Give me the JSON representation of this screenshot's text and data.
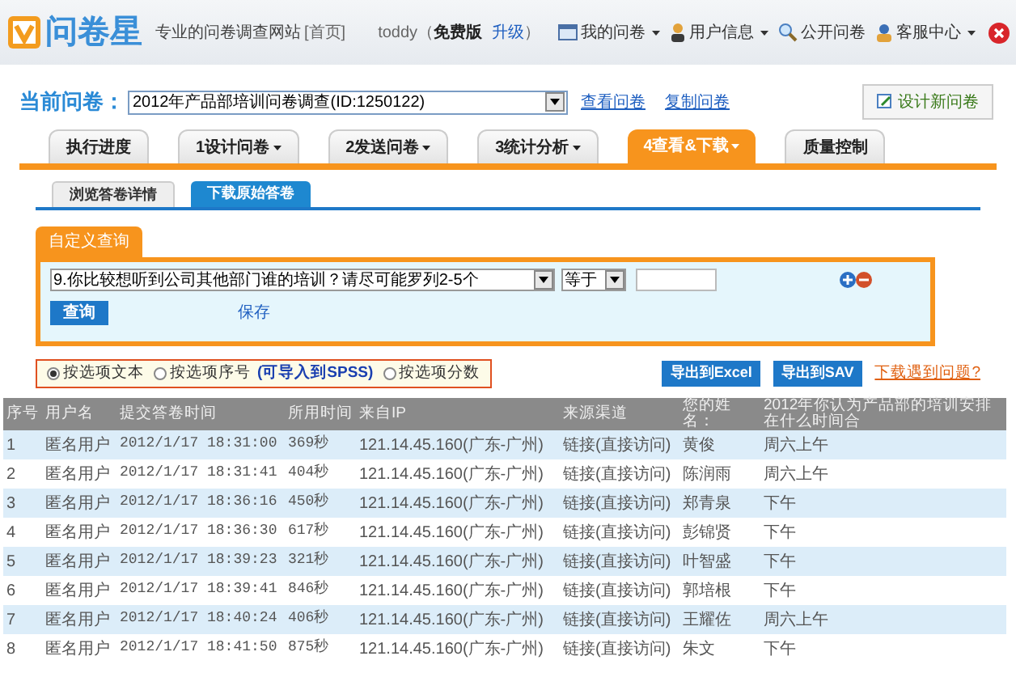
{
  "header": {
    "logo": "问卷星",
    "tagline": "专业的问卷调查网站",
    "home_link": "[首页]",
    "user": "toddy（",
    "edition": "免费版",
    "upgrade": "升级",
    "user_suffix": "）",
    "nav": [
      {
        "label": "我的问卷",
        "kind": "folder",
        "dropdown": true
      },
      {
        "label": "用户信息",
        "kind": "user",
        "dropdown": true
      },
      {
        "label": "公开问卷",
        "kind": "search",
        "dropdown": false
      },
      {
        "label": "客服中心",
        "kind": "support",
        "dropdown": true
      }
    ]
  },
  "current": {
    "label": "当前问卷：",
    "value": "2012年产品部培训问卷调查(ID:1250122)",
    "links": [
      "查看问卷",
      "复制问卷"
    ],
    "new_button": "设计新问卷"
  },
  "tabs": [
    {
      "label": "执行进度",
      "dropdown": false,
      "selected": false
    },
    {
      "label": "1设计问卷",
      "dropdown": true,
      "selected": false
    },
    {
      "label": "2发送问卷",
      "dropdown": true,
      "selected": false
    },
    {
      "label": "3统计分析",
      "dropdown": true,
      "selected": false
    },
    {
      "label": "4查看&下载",
      "dropdown": true,
      "selected": true
    },
    {
      "label": "质量控制",
      "dropdown": false,
      "selected": false
    }
  ],
  "subtabs": [
    {
      "label": "浏览答卷详情",
      "selected": false
    },
    {
      "label": "下载原始答卷",
      "selected": true
    }
  ],
  "query": {
    "title": "自定义查询",
    "question": "9.你比较想听到公司其他部门谁的培训？请尽可能罗列2-5个",
    "operator": "等于",
    "search_button": "查询",
    "save_link": "保存"
  },
  "options": [
    {
      "label": "按选项文本",
      "selected": true
    },
    {
      "label": "按选项序号",
      "note": "(可导入到SPSS)",
      "selected": false
    },
    {
      "label": "按选项分数",
      "selected": false
    }
  ],
  "exports": {
    "buttons": [
      "导出到Excel",
      "导出到SAV"
    ],
    "help_link": "下载遇到问题?"
  },
  "table": {
    "columns": [
      "序号",
      "用户名",
      "提交答卷时间",
      "所用时间",
      "来自IP",
      "来源渠道",
      "您的姓名：",
      "2012年你认为产品部的培训安排在什么时间合"
    ],
    "rows": [
      [
        "1",
        "匿名用户",
        "2012/1/17 18:31:00",
        "369秒",
        "121.14.45.160(广东-广州)",
        "链接(直接访问)",
        "黄俊",
        "周六上午"
      ],
      [
        "2",
        "匿名用户",
        "2012/1/17 18:31:41",
        "404秒",
        "121.14.45.160(广东-广州)",
        "链接(直接访问)",
        "陈润雨",
        "周六上午"
      ],
      [
        "3",
        "匿名用户",
        "2012/1/17 18:36:16",
        "450秒",
        "121.14.45.160(广东-广州)",
        "链接(直接访问)",
        "郑青泉",
        "下午"
      ],
      [
        "4",
        "匿名用户",
        "2012/1/17 18:36:30",
        "617秒",
        "121.14.45.160(广东-广州)",
        "链接(直接访问)",
        "彭锦贤",
        "下午"
      ],
      [
        "5",
        "匿名用户",
        "2012/1/17 18:39:23",
        "321秒",
        "121.14.45.160(广东-广州)",
        "链接(直接访问)",
        "叶智盛",
        "下午"
      ],
      [
        "6",
        "匿名用户",
        "2012/1/17 18:39:41",
        "846秒",
        "121.14.45.160(广东-广州)",
        "链接(直接访问)",
        "郭培根",
        "下午"
      ],
      [
        "7",
        "匿名用户",
        "2012/1/17 18:40:24",
        "406秒",
        "121.14.45.160(广东-广州)",
        "链接(直接访问)",
        "王耀佐",
        "周六上午"
      ],
      [
        "8",
        "匿名用户",
        "2012/1/17 18:41:50",
        "875秒",
        "121.14.45.160(广东-广州)",
        "链接(直接访问)",
        "朱文",
        "下午"
      ]
    ]
  }
}
